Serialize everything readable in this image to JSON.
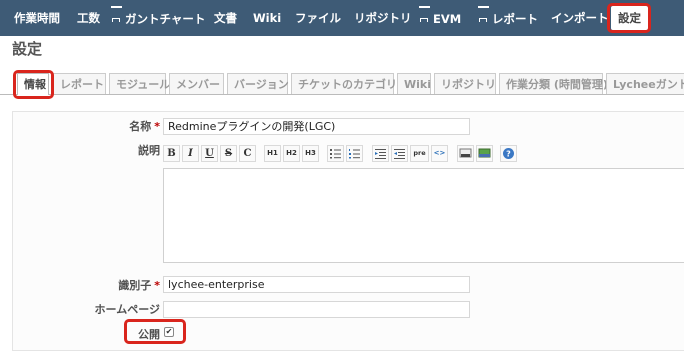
{
  "menu": {
    "items": [
      "作業時間",
      "工数",
      "ガントチャート",
      "文書",
      "Wiki",
      "ファイル",
      "リポジトリ",
      "EVM",
      "レポート",
      "インポート",
      "設定"
    ],
    "selected": "設定"
  },
  "page": {
    "title": "設定"
  },
  "tabs": {
    "items": [
      "情報",
      "レポート",
      "モジュール",
      "メンバー",
      "バージョン",
      "チケットのカテゴリ",
      "Wiki",
      "リポジトリ",
      "作業分類 (時間管理)",
      "Lycheeガント"
    ],
    "selected": "情報"
  },
  "form": {
    "name": {
      "label": "名称",
      "required_mark": "*",
      "value": "Redmineプラグインの開発(LGC)"
    },
    "description": {
      "label": "説明"
    },
    "toolbar": [
      "B",
      "I",
      "U",
      "S",
      "C",
      "H1",
      "H2",
      "H3",
      "ul",
      "ol",
      "indent-left",
      "indent-right",
      "pre",
      "code",
      "link",
      "image",
      "help"
    ],
    "identifier": {
      "label": "識別子",
      "required_mark": "*",
      "value": "lychee-enterprise"
    },
    "homepage": {
      "label": "ホームページ",
      "value": ""
    },
    "public": {
      "label": "公開",
      "checked": true,
      "check_glyph": "✔"
    }
  },
  "colors": {
    "menubar": "#3e5b76",
    "highlight": "#d9251d",
    "required": "#bb0000"
  },
  "icons": [
    "chart-icon",
    "bold-icon",
    "italic-icon",
    "underline-icon",
    "strike-icon",
    "code-icon",
    "heading1-icon",
    "heading2-icon",
    "heading3-icon",
    "bullet-list-icon",
    "numbered-list-icon",
    "outdent-icon",
    "indent-icon",
    "pre-icon",
    "inline-code-icon",
    "link-icon",
    "image-icon",
    "help-icon"
  ]
}
